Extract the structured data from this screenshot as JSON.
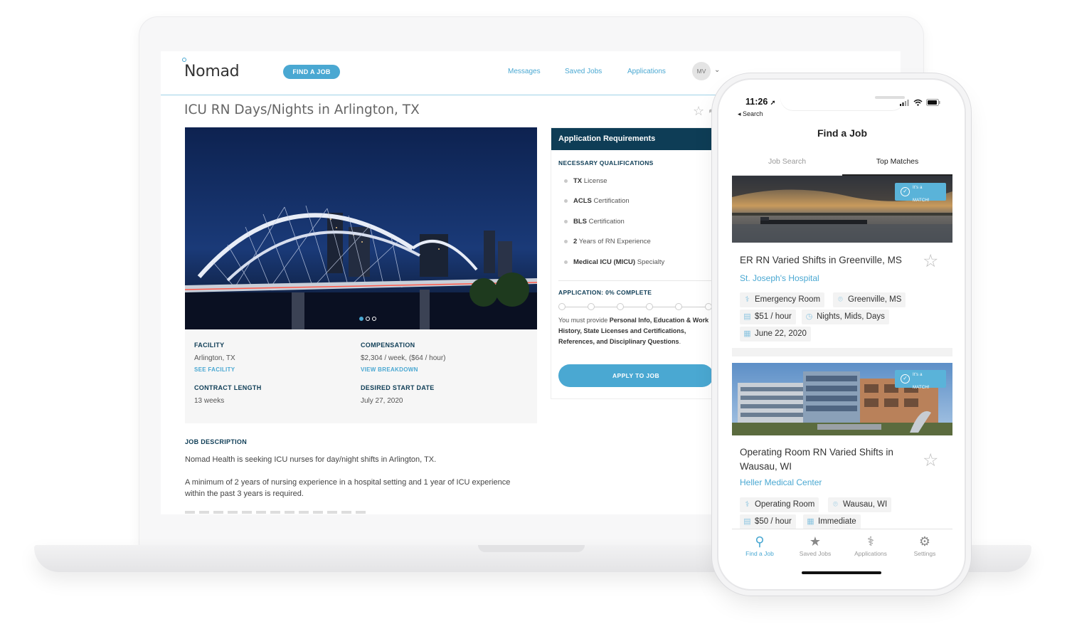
{
  "web": {
    "logo": "Nomad",
    "find_job_button": "FIND A JOB",
    "nav": {
      "messages": "Messages",
      "saved_jobs": "Saved Jobs",
      "applications": "Applications"
    },
    "avatar_initials": "MV",
    "job_title": "ICU RN Days/Nights in Arlington, TX",
    "facility": {
      "label": "FACILITY",
      "value": "Arlington, TX",
      "link": "SEE FACILITY"
    },
    "compensation": {
      "label": "COMPENSATION",
      "value": "$2,304 / week, ($64 / hour)",
      "link": "VIEW BREAKDOWN"
    },
    "contract_length": {
      "label": "CONTRACT LENGTH",
      "value": "13 weeks"
    },
    "desired_start_date": {
      "label": "DESIRED START DATE",
      "value": "July 27, 2020"
    },
    "job_description": {
      "label": "JOB DESCRIPTION",
      "p1": "Nomad Health is seeking ICU nurses for day/night shifts in Arlington, TX.",
      "p2": "A minimum of 2 years of nursing experience in a hospital setting and 1 year of ICU experience within the past 3 years is required."
    },
    "requirements": {
      "header": "Application Requirements",
      "quals_label": "NECESSARY QUALIFICATIONS",
      "quals": [
        {
          "bold": "TX",
          "rest": "License"
        },
        {
          "bold": "ACLS",
          "rest": "Certification"
        },
        {
          "bold": "BLS",
          "rest": "Certification"
        },
        {
          "bold": "2",
          "rest": "Years of RN Experience"
        },
        {
          "bold": "Medical ICU (MICU)",
          "rest": "Specialty"
        }
      ],
      "progress_label": "APPLICATION: 0% COMPLETE",
      "progress_percent": 0,
      "note_prefix": "You must provide",
      "note_bold": "Personal Info, Education & Work History, State Licenses and Certifications, References, and Disciplinary Questions",
      "note_suffix": ".",
      "apply_button": "APPLY TO JOB"
    }
  },
  "phone": {
    "time": "11:26",
    "back": "◂ Search",
    "title": "Find a Job",
    "tabs": [
      "Job Search",
      "Top Matches"
    ],
    "match_badge": [
      "It's a",
      "MATCH!"
    ],
    "cards": [
      {
        "title": "ER RN Varied Shifts in Greenville, MS",
        "hospital": "St. Joseph's Hospital",
        "tags": {
          "unit": "Emergency Room",
          "location": "Greenville, MS",
          "pay": "$51 / hour",
          "shifts": "Nights, Mids, Days",
          "start": "June 22, 2020"
        }
      },
      {
        "title": "Operating Room RN Varied Shifts in Wausau, WI",
        "hospital": "Heller Medical Center",
        "tags": {
          "unit": "Operating Room",
          "location": "Wausau, WI",
          "pay": "$50 / hour",
          "start": "Immediate"
        }
      }
    ],
    "tabbar": [
      "Find a Job",
      "Saved Jobs",
      "Applications",
      "Settings"
    ]
  },
  "colors": {
    "accent": "#4aa8d2",
    "navy": "#0e3d56"
  }
}
